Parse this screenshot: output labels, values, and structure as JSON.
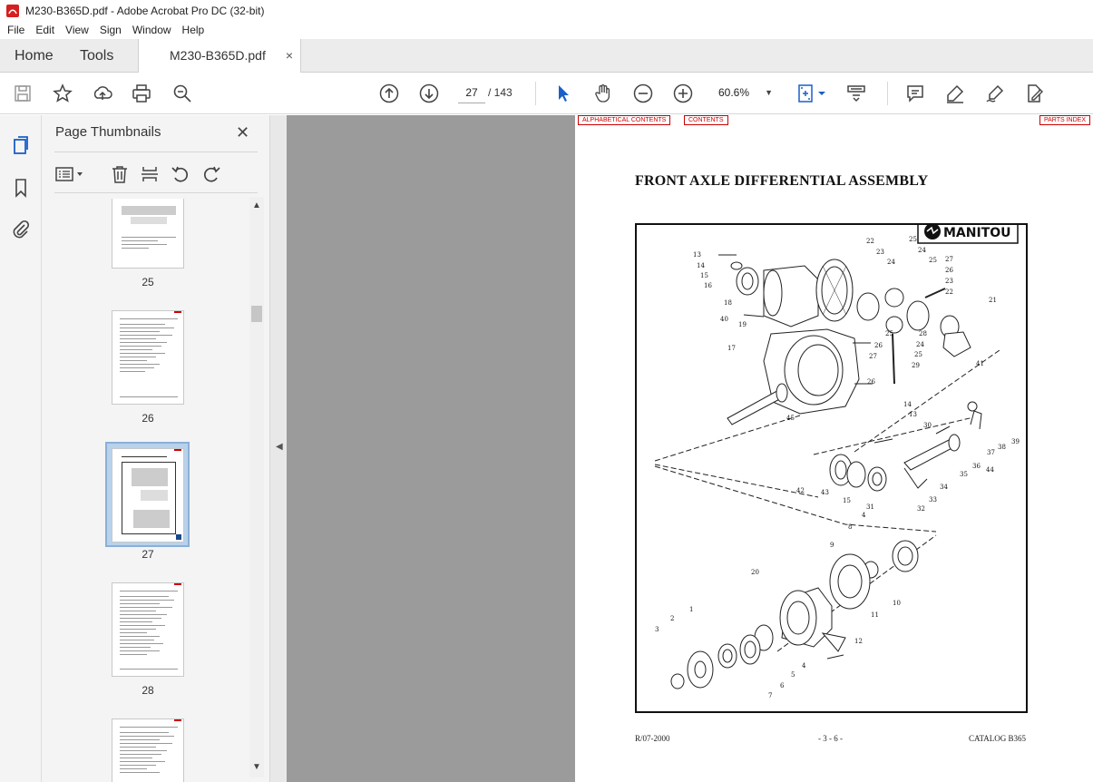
{
  "window": {
    "title": "M230-B365D.pdf - Adobe Acrobat Pro DC (32-bit)"
  },
  "menu": [
    "File",
    "Edit",
    "View",
    "Sign",
    "Window",
    "Help"
  ],
  "tabs": {
    "home": "Home",
    "tools": "Tools",
    "document": "M230-B365D.pdf",
    "close": "×"
  },
  "toolbar": {
    "current_page": "27",
    "page_total": "/ 143",
    "zoom": "60.6%",
    "icons": [
      "save-icon",
      "bookmark-star-icon",
      "upload-icon",
      "print-icon",
      "zoom-search-icon",
      "prev-page-icon",
      "next-page-icon",
      "select-cursor-icon",
      "hand-icon",
      "zoom-out-icon",
      "zoom-in-icon",
      "page-fit-icon",
      "scroll-mode-icon",
      "comment-icon",
      "highlight-icon",
      "sign-icon",
      "edit-pdf-icon"
    ]
  },
  "panel": {
    "title": "Page Thumbnails",
    "close": "✕",
    "thumbnails": [
      {
        "label": "25"
      },
      {
        "label": "26"
      },
      {
        "label": "27",
        "selected": true
      },
      {
        "label": "28"
      },
      {
        "label": ""
      }
    ]
  },
  "page": {
    "links": {
      "alphabetical": "ALPHABETICAL CONTENTS",
      "contents": "CONTENTS",
      "parts_index": "PARTS INDEX"
    },
    "title": "FRONT AXLE DIFFERENTIAL ASSEMBLY",
    "logo_text": "MANITOU",
    "callouts": [
      "13",
      "14",
      "15",
      "16",
      "18",
      "40",
      "19",
      "17",
      "22",
      "23",
      "24",
      "25",
      "24",
      "25",
      "27",
      "26",
      "23",
      "22",
      "21",
      "25",
      "26",
      "27",
      "28",
      "24",
      "25",
      "29",
      "26",
      "41",
      "45",
      "14",
      "13",
      "30",
      "39",
      "38",
      "37",
      "36",
      "44",
      "35",
      "34",
      "33",
      "32",
      "31",
      "15",
      "43",
      "42",
      "4",
      "8",
      "9",
      "20",
      "10",
      "11",
      "12",
      "1",
      "2",
      "3",
      "4",
      "5",
      "6",
      "7"
    ],
    "footer": {
      "left": "R/07-2000",
      "center": "- 3 - 6 -",
      "right": "CATALOG B365"
    }
  },
  "colors": {
    "accent_red": "#cc0000",
    "select_blue": "#b8d2ec",
    "doc_bg": "#9b9b9b"
  }
}
